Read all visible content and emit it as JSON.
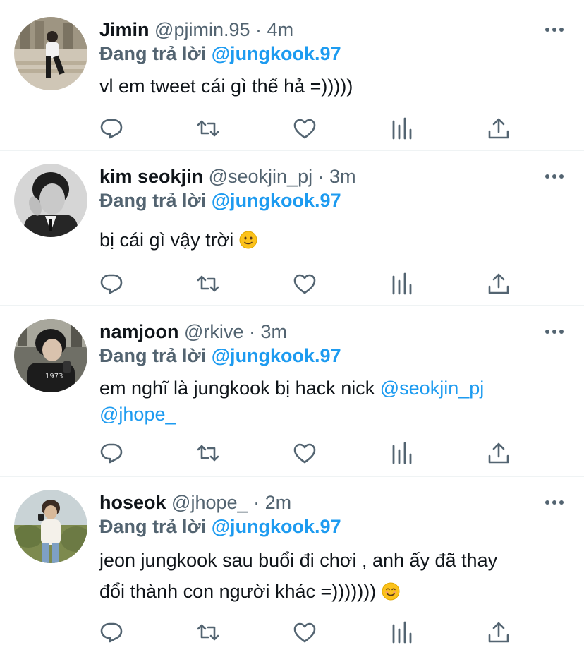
{
  "colors": {
    "accent": "#1d9bf0",
    "secondary": "#536471",
    "text": "#0f1419",
    "divider": "#eff3f4"
  },
  "tweets": [
    {
      "name": "Jimin",
      "handle": "@pjimin.95",
      "sep": "·",
      "time": "4m",
      "reply_label": "Đang trả lời",
      "reply_to": "@jungkook.97",
      "body_line1": "vl em tweet cái gì thế hả =)))))"
    },
    {
      "name": "kim seokjin",
      "handle": "@seokjin_pj",
      "sep": "·",
      "time": "3m",
      "reply_label": "Đang trả lời",
      "reply_to": "@jungkook.97",
      "body_line1": "bị cái gì vậy trời",
      "emoji": "slightly-smiling-face-icon"
    },
    {
      "name": "namjoon",
      "handle": "@rkive",
      "sep": "·",
      "time": "3m",
      "reply_label": "Đang trả lời",
      "reply_to": "@jungkook.97",
      "body_line1": "em nghĩ là jungkook bị hack nick",
      "mention1": "@seokjin_pj",
      "mention2": "@jhope_"
    },
    {
      "name": "hoseok",
      "handle": "@jhope_",
      "sep": "·",
      "time": "2m",
      "reply_label": "Đang trả lời",
      "reply_to": "@jungkook.97",
      "body_line1": "jeon jungkook sau buổi đi chơi , anh ấy đã thay",
      "body_line2": "đổi thành con người khác =)))))))",
      "emoji": "smiling-face-icon"
    }
  ]
}
